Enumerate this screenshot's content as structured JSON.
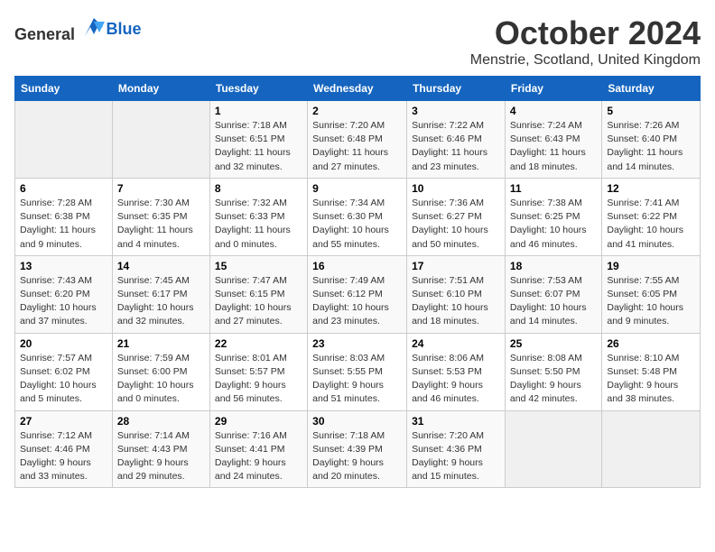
{
  "header": {
    "logo_general": "General",
    "logo_blue": "Blue",
    "title": "October 2024",
    "location": "Menstrie, Scotland, United Kingdom"
  },
  "weekdays": [
    "Sunday",
    "Monday",
    "Tuesday",
    "Wednesday",
    "Thursday",
    "Friday",
    "Saturday"
  ],
  "weeks": [
    [
      {
        "day": "",
        "sunrise": "",
        "sunset": "",
        "daylight": ""
      },
      {
        "day": "",
        "sunrise": "",
        "sunset": "",
        "daylight": ""
      },
      {
        "day": "1",
        "sunrise": "Sunrise: 7:18 AM",
        "sunset": "Sunset: 6:51 PM",
        "daylight": "Daylight: 11 hours and 32 minutes."
      },
      {
        "day": "2",
        "sunrise": "Sunrise: 7:20 AM",
        "sunset": "Sunset: 6:48 PM",
        "daylight": "Daylight: 11 hours and 27 minutes."
      },
      {
        "day": "3",
        "sunrise": "Sunrise: 7:22 AM",
        "sunset": "Sunset: 6:46 PM",
        "daylight": "Daylight: 11 hours and 23 minutes."
      },
      {
        "day": "4",
        "sunrise": "Sunrise: 7:24 AM",
        "sunset": "Sunset: 6:43 PM",
        "daylight": "Daylight: 11 hours and 18 minutes."
      },
      {
        "day": "5",
        "sunrise": "Sunrise: 7:26 AM",
        "sunset": "Sunset: 6:40 PM",
        "daylight": "Daylight: 11 hours and 14 minutes."
      }
    ],
    [
      {
        "day": "6",
        "sunrise": "Sunrise: 7:28 AM",
        "sunset": "Sunset: 6:38 PM",
        "daylight": "Daylight: 11 hours and 9 minutes."
      },
      {
        "day": "7",
        "sunrise": "Sunrise: 7:30 AM",
        "sunset": "Sunset: 6:35 PM",
        "daylight": "Daylight: 11 hours and 4 minutes."
      },
      {
        "day": "8",
        "sunrise": "Sunrise: 7:32 AM",
        "sunset": "Sunset: 6:33 PM",
        "daylight": "Daylight: 11 hours and 0 minutes."
      },
      {
        "day": "9",
        "sunrise": "Sunrise: 7:34 AM",
        "sunset": "Sunset: 6:30 PM",
        "daylight": "Daylight: 10 hours and 55 minutes."
      },
      {
        "day": "10",
        "sunrise": "Sunrise: 7:36 AM",
        "sunset": "Sunset: 6:27 PM",
        "daylight": "Daylight: 10 hours and 50 minutes."
      },
      {
        "day": "11",
        "sunrise": "Sunrise: 7:38 AM",
        "sunset": "Sunset: 6:25 PM",
        "daylight": "Daylight: 10 hours and 46 minutes."
      },
      {
        "day": "12",
        "sunrise": "Sunrise: 7:41 AM",
        "sunset": "Sunset: 6:22 PM",
        "daylight": "Daylight: 10 hours and 41 minutes."
      }
    ],
    [
      {
        "day": "13",
        "sunrise": "Sunrise: 7:43 AM",
        "sunset": "Sunset: 6:20 PM",
        "daylight": "Daylight: 10 hours and 37 minutes."
      },
      {
        "day": "14",
        "sunrise": "Sunrise: 7:45 AM",
        "sunset": "Sunset: 6:17 PM",
        "daylight": "Daylight: 10 hours and 32 minutes."
      },
      {
        "day": "15",
        "sunrise": "Sunrise: 7:47 AM",
        "sunset": "Sunset: 6:15 PM",
        "daylight": "Daylight: 10 hours and 27 minutes."
      },
      {
        "day": "16",
        "sunrise": "Sunrise: 7:49 AM",
        "sunset": "Sunset: 6:12 PM",
        "daylight": "Daylight: 10 hours and 23 minutes."
      },
      {
        "day": "17",
        "sunrise": "Sunrise: 7:51 AM",
        "sunset": "Sunset: 6:10 PM",
        "daylight": "Daylight: 10 hours and 18 minutes."
      },
      {
        "day": "18",
        "sunrise": "Sunrise: 7:53 AM",
        "sunset": "Sunset: 6:07 PM",
        "daylight": "Daylight: 10 hours and 14 minutes."
      },
      {
        "day": "19",
        "sunrise": "Sunrise: 7:55 AM",
        "sunset": "Sunset: 6:05 PM",
        "daylight": "Daylight: 10 hours and 9 minutes."
      }
    ],
    [
      {
        "day": "20",
        "sunrise": "Sunrise: 7:57 AM",
        "sunset": "Sunset: 6:02 PM",
        "daylight": "Daylight: 10 hours and 5 minutes."
      },
      {
        "day": "21",
        "sunrise": "Sunrise: 7:59 AM",
        "sunset": "Sunset: 6:00 PM",
        "daylight": "Daylight: 10 hours and 0 minutes."
      },
      {
        "day": "22",
        "sunrise": "Sunrise: 8:01 AM",
        "sunset": "Sunset: 5:57 PM",
        "daylight": "Daylight: 9 hours and 56 minutes."
      },
      {
        "day": "23",
        "sunrise": "Sunrise: 8:03 AM",
        "sunset": "Sunset: 5:55 PM",
        "daylight": "Daylight: 9 hours and 51 minutes."
      },
      {
        "day": "24",
        "sunrise": "Sunrise: 8:06 AM",
        "sunset": "Sunset: 5:53 PM",
        "daylight": "Daylight: 9 hours and 46 minutes."
      },
      {
        "day": "25",
        "sunrise": "Sunrise: 8:08 AM",
        "sunset": "Sunset: 5:50 PM",
        "daylight": "Daylight: 9 hours and 42 minutes."
      },
      {
        "day": "26",
        "sunrise": "Sunrise: 8:10 AM",
        "sunset": "Sunset: 5:48 PM",
        "daylight": "Daylight: 9 hours and 38 minutes."
      }
    ],
    [
      {
        "day": "27",
        "sunrise": "Sunrise: 7:12 AM",
        "sunset": "Sunset: 4:46 PM",
        "daylight": "Daylight: 9 hours and 33 minutes."
      },
      {
        "day": "28",
        "sunrise": "Sunrise: 7:14 AM",
        "sunset": "Sunset: 4:43 PM",
        "daylight": "Daylight: 9 hours and 29 minutes."
      },
      {
        "day": "29",
        "sunrise": "Sunrise: 7:16 AM",
        "sunset": "Sunset: 4:41 PM",
        "daylight": "Daylight: 9 hours and 24 minutes."
      },
      {
        "day": "30",
        "sunrise": "Sunrise: 7:18 AM",
        "sunset": "Sunset: 4:39 PM",
        "daylight": "Daylight: 9 hours and 20 minutes."
      },
      {
        "day": "31",
        "sunrise": "Sunrise: 7:20 AM",
        "sunset": "Sunset: 4:36 PM",
        "daylight": "Daylight: 9 hours and 15 minutes."
      },
      {
        "day": "",
        "sunrise": "",
        "sunset": "",
        "daylight": ""
      },
      {
        "day": "",
        "sunrise": "",
        "sunset": "",
        "daylight": ""
      }
    ]
  ]
}
